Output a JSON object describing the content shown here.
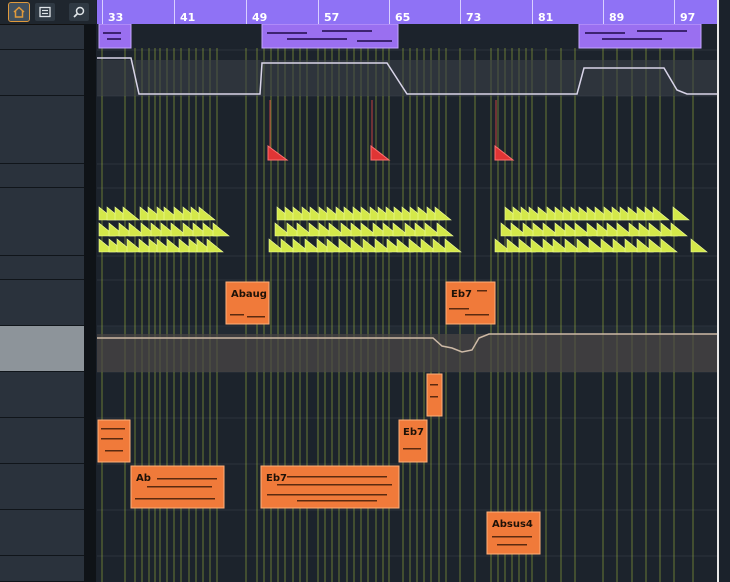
{
  "toolbar": {
    "icons": [
      "home-folder-icon",
      "list-icon",
      "search-icon"
    ]
  },
  "ruler": {
    "bars": [
      "33",
      "41",
      "49",
      "57",
      "65",
      "73",
      "81",
      "89",
      "97"
    ]
  },
  "parts": {
    "chords": [
      {
        "label": "Abaug"
      },
      {
        "label": "Eb7"
      },
      {
        "label": "Eb7"
      },
      {
        "label": "Ab"
      },
      {
        "label": "Eb7"
      },
      {
        "label": "Absus4"
      }
    ]
  },
  "colors": {
    "ruler": "#8f72f5",
    "midi_part": "#f07a3a",
    "purple_part": "#9a6ff0",
    "marker": "#e03535",
    "note_trigger": "#d4e84a",
    "gridline": "#a9c23a"
  }
}
